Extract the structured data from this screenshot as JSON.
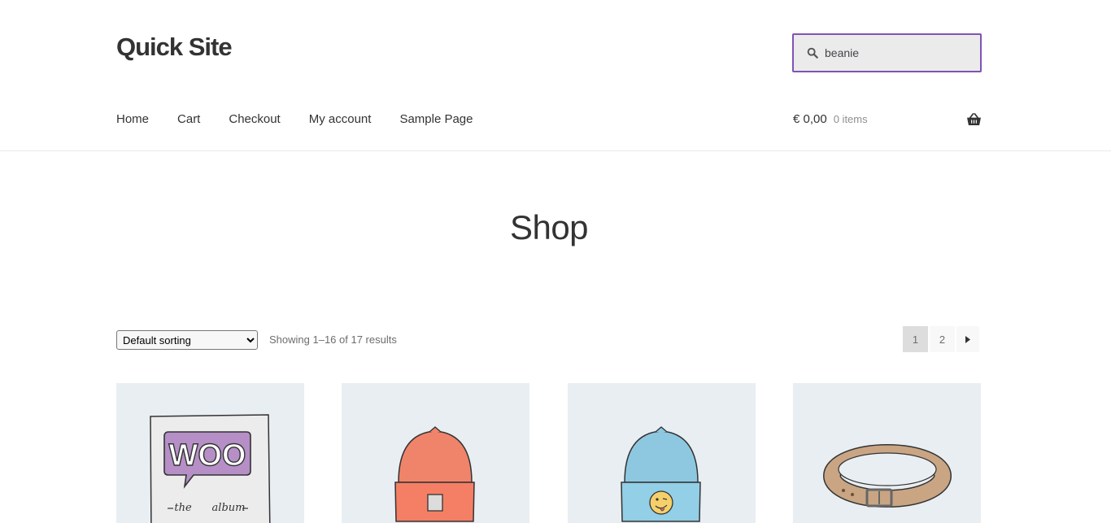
{
  "site": {
    "title": "Quick Site"
  },
  "search": {
    "value": "beanie"
  },
  "nav": {
    "items": [
      {
        "label": "Home"
      },
      {
        "label": "Cart"
      },
      {
        "label": "Checkout"
      },
      {
        "label": "My account"
      },
      {
        "label": "Sample Page"
      }
    ]
  },
  "cart": {
    "amount": "€ 0,00",
    "count": "0 items"
  },
  "main": {
    "title": "Shop"
  },
  "toolbar": {
    "sort_selected": "Default sorting",
    "result_count": "Showing 1–16 of 17 results"
  },
  "pagination": {
    "pages": [
      "1",
      "2"
    ],
    "current": "1"
  },
  "products": [
    {
      "image": "woo-album-image",
      "art_text_1": "WOO",
      "art_text_2": "the",
      "art_text_3": "album"
    },
    {
      "image": "orange-beanie-image"
    },
    {
      "image": "blue-beanie-image"
    },
    {
      "image": "brown-belt-image"
    }
  ],
  "colors": {
    "accent": "#7f54b3",
    "text": "#333333",
    "muted": "#6d6d6d"
  }
}
